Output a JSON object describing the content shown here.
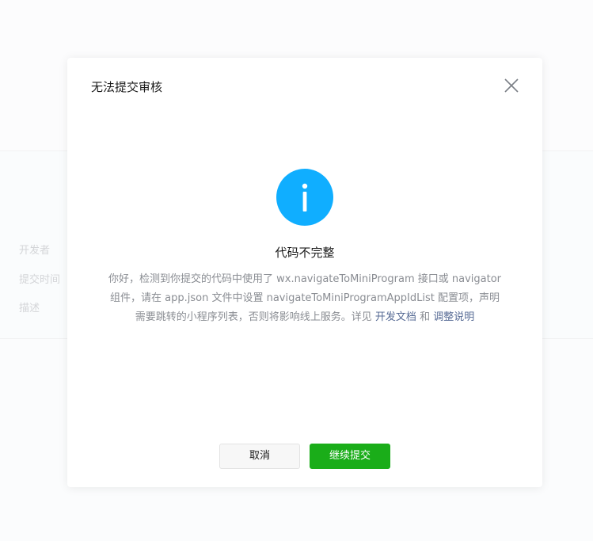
{
  "background": {
    "labels": [
      "开发者",
      "提交时间",
      "描述"
    ]
  },
  "dialog": {
    "title": "无法提交审核",
    "heading": "代码不完整",
    "description_parts": {
      "main": "你好，检测到你提交的代码中使用了 wx.navigateToMiniProgram 接口或 navigator 组件，请在 app.json 文件中设置 navigateToMiniProgramAppIdList 配置项，声明需要跳转的小程序列表，否则将影响线上服务。详见 ",
      "link1": "开发文档",
      "conj": " 和 ",
      "link2": "调整说明"
    },
    "buttons": {
      "cancel": "取消",
      "continue": "继续提交"
    },
    "icons": {
      "status": "info-icon",
      "close": "close-icon"
    }
  },
  "colors": {
    "info_blue": "#10aeff",
    "primary_green": "#1aad19",
    "link_blue": "#576b95",
    "text_secondary": "#8a8d93"
  }
}
